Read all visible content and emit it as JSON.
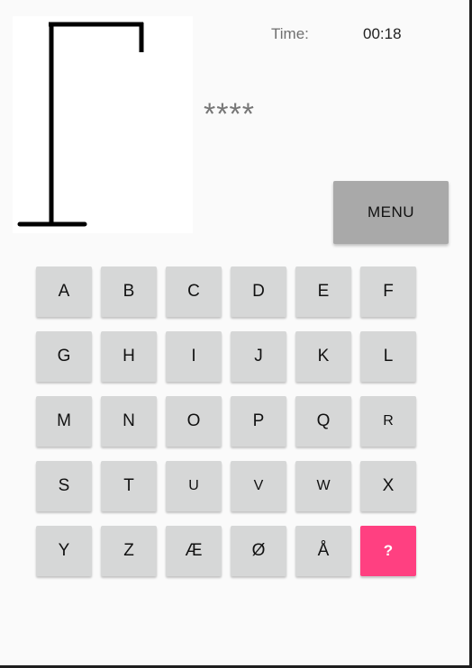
{
  "header": {
    "timer_label": "Time:",
    "timer_value": "00:18"
  },
  "game": {
    "masked_word": "****",
    "menu_label": "MENU"
  },
  "keyboard": {
    "keys": [
      "A",
      "B",
      "C",
      "D",
      "E",
      "F",
      "G",
      "H",
      "I",
      "J",
      "K",
      "L",
      "M",
      "N",
      "O",
      "P",
      "Q",
      "R",
      "S",
      "T",
      "U",
      "V",
      "W",
      "X",
      "Y",
      "Z",
      "Æ",
      "Ø",
      "Å",
      "?"
    ]
  },
  "colors": {
    "key_background": "#d6d7d7",
    "accent_key": "#ff4081",
    "menu_button": "#a9a9a9",
    "gallows": "#000000"
  }
}
